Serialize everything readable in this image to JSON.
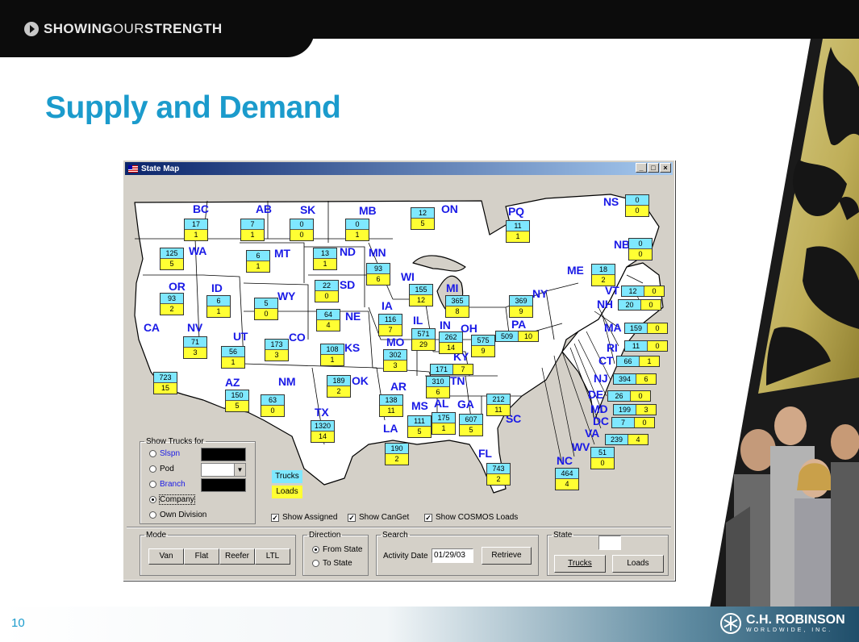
{
  "brand": {
    "bold_a": "SHOWING",
    "thin": "OUR",
    "bold_b": "STRENGTH"
  },
  "slide": {
    "title": "Supply and Demand",
    "page_number": "10"
  },
  "logo": {
    "name": "C.H. ROBINSON",
    "sub": "WORLDWIDE, INC."
  },
  "window": {
    "title": "State Map",
    "buttons": {
      "minimize": "_",
      "maximize": "□",
      "close": "×"
    }
  },
  "states": {
    "BC": "BC",
    "AB": "AB",
    "SK": "SK",
    "MB": "MB",
    "ON": "ON",
    "PQ": "PQ",
    "NS": "NS",
    "NB": "NB",
    "WA": "WA",
    "MT": "MT",
    "ND": "ND",
    "MN": "MN",
    "ME": "ME",
    "OR": "OR",
    "ID": "ID",
    "WY": "WY",
    "SD": "SD",
    "WI": "WI",
    "MI": "MI",
    "NY": "NY",
    "VT": "VT",
    "NH": "NH",
    "CA": "CA",
    "NV": "NV",
    "UT": "UT",
    "CO": "CO",
    "NE": "NE",
    "IA": "IA",
    "IL": "IL",
    "IN": "IN",
    "OH": "OH",
    "PA": "PA",
    "MA": "MA",
    "RI": "RI",
    "CT": "CT",
    "KS": "KS",
    "MO": "MO",
    "KY": "KY",
    "NJ": "NJ",
    "AZ": "AZ",
    "NM": "NM",
    "OK": "OK",
    "AR": "AR",
    "TN": "TN",
    "DE": "DE",
    "MD": "MD",
    "DC": "DC",
    "VA": "VA",
    "TX": "TX",
    "MS": "MS",
    "AL": "AL",
    "GA": "GA",
    "SC": "SC",
    "LA": "LA",
    "FL": "FL",
    "NC": "NC",
    "WV": "WV"
  },
  "counts": {
    "BC": {
      "trucks": "17",
      "loads": "1"
    },
    "AB": {
      "trucks": "7",
      "loads": "1"
    },
    "SK": {
      "trucks": "0",
      "loads": "0"
    },
    "MB": {
      "trucks": "0",
      "loads": "1"
    },
    "ON": {
      "trucks": "12",
      "loads": "5"
    },
    "PQ": {
      "trucks": "11",
      "loads": "1"
    },
    "NS": {
      "trucks": "0",
      "loads": "0"
    },
    "NB": {
      "trucks": "0",
      "loads": "0"
    },
    "WA": {
      "trucks": "125",
      "loads": "5"
    },
    "MT": {
      "trucks": "6",
      "loads": "1"
    },
    "ND": {
      "trucks": "13",
      "loads": "1"
    },
    "MN": {
      "trucks": "93",
      "loads": "6"
    },
    "ME": {
      "trucks": "18",
      "loads": "2"
    },
    "OR": {
      "trucks": "93",
      "loads": "2"
    },
    "ID": {
      "trucks": "6",
      "loads": "1"
    },
    "WY": {
      "trucks": "5",
      "loads": "0"
    },
    "SD": {
      "trucks": "22",
      "loads": "0"
    },
    "WI": {
      "trucks": "155",
      "loads": "12"
    },
    "MI": {
      "trucks": "365",
      "loads": "8"
    },
    "NY": {
      "trucks": "369",
      "loads": "9"
    },
    "VT": {
      "trucks": "12",
      "loads": "0"
    },
    "NH": {
      "trucks": "20",
      "loads": "0"
    },
    "CA": {
      "trucks": "723",
      "loads": "15"
    },
    "NV": {
      "trucks": "71",
      "loads": "3"
    },
    "UT": {
      "trucks": "56",
      "loads": "1"
    },
    "CO": {
      "trucks": "173",
      "loads": "3"
    },
    "NE": {
      "trucks": "64",
      "loads": "4"
    },
    "IA": {
      "trucks": "116",
      "loads": "7"
    },
    "IL": {
      "trucks": "571",
      "loads": "29"
    },
    "IN": {
      "trucks": "262",
      "loads": "14"
    },
    "OH": {
      "trucks": "575",
      "loads": "9"
    },
    "PA": {
      "trucks": "509",
      "loads": "10"
    },
    "MA": {
      "trucks": "159",
      "loads": "0"
    },
    "RI": {
      "trucks": "11",
      "loads": "0"
    },
    "CT": {
      "trucks": "66",
      "loads": "1"
    },
    "KS": {
      "trucks": "108",
      "loads": "1"
    },
    "MO": {
      "trucks": "302",
      "loads": "3"
    },
    "KY": {
      "trucks": "171",
      "loads": "7"
    },
    "NJ": {
      "trucks": "394",
      "loads": "6"
    },
    "AZ": {
      "trucks": "150",
      "loads": "5"
    },
    "NM": {
      "trucks": "63",
      "loads": "0"
    },
    "OK": {
      "trucks": "189",
      "loads": "2"
    },
    "AR": {
      "trucks": "138",
      "loads": "11"
    },
    "TN": {
      "trucks": "310",
      "loads": "6"
    },
    "DE": {
      "trucks": "26",
      "loads": "0"
    },
    "MD": {
      "trucks": "199",
      "loads": "3"
    },
    "DC": {
      "trucks": "7",
      "loads": "0"
    },
    "VA": {
      "trucks": "239",
      "loads": "4"
    },
    "TX": {
      "trucks": "1320",
      "loads": "14"
    },
    "MS": {
      "trucks": "111",
      "loads": "5"
    },
    "AL": {
      "trucks": "175",
      "loads": "1"
    },
    "GA": {
      "trucks": "607",
      "loads": "5"
    },
    "SC": {
      "trucks": "212",
      "loads": "11"
    },
    "LA": {
      "trucks": "190",
      "loads": "2"
    },
    "FL": {
      "trucks": "743",
      "loads": "2"
    },
    "NC": {
      "trucks": "464",
      "loads": "4"
    },
    "WV": {
      "trucks": "51",
      "loads": "0"
    }
  },
  "show_trucks": {
    "legend": "Show Trucks for",
    "slspn": "Slspn",
    "pod": "Pod",
    "branch": "Branch",
    "company": "Company",
    "own_division": "Own Division",
    "selected": "Company"
  },
  "map_legend": {
    "trucks": "Trucks",
    "loads": "Loads"
  },
  "checkboxes": {
    "show_assigned": "Show Assigned",
    "show_canget": "Show CanGet",
    "show_cosmos": "Show COSMOS Loads"
  },
  "mode": {
    "legend": "Mode",
    "van": "Van",
    "flat": "Flat",
    "reefer": "Reefer",
    "ltl": "LTL"
  },
  "direction": {
    "legend": "Direction",
    "from_state": "From State",
    "to_state": "To State",
    "selected": "From State"
  },
  "search": {
    "legend": "Search",
    "activity_label": "Activity Date",
    "activity_date": "01/29/03",
    "retrieve": "Retrieve"
  },
  "state_panel": {
    "legend": "State",
    "value": "",
    "trucks": "Trucks",
    "loads": "Loads"
  },
  "colors": {
    "title_blue": "#1b9bcc",
    "state_label": "#1a1ae6",
    "trucks_cell": "#7fe8ff",
    "loads_cell": "#ffff33",
    "window_face": "#d4d0c8"
  }
}
